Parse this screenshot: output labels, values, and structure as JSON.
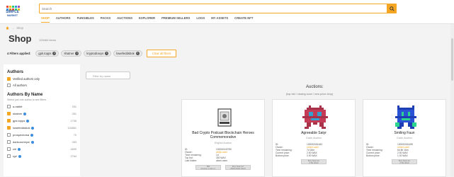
{
  "logo": {
    "text1": "SIMPLE",
    "text2": "MARKET",
    "text3": "PLACE"
  },
  "search": {
    "placeholder": "Search"
  },
  "nav": [
    "SHOP",
    "AUTHORS",
    "FUNGIBLES",
    "PACKS",
    "AUCTIONS",
    "EXPLORER",
    "PREMIUM SELLERS",
    "LOGS",
    "MY ASSETS",
    "CREATE NFT"
  ],
  "breadcrumb": {
    "current": "Shop"
  },
  "page": {
    "title": "Shop",
    "count": "125464 items"
  },
  "filters": {
    "label": "4 Filters applied:",
    "chips": [
      "gpk.topps",
      "shatner",
      "kryptodraxys",
      "lowefeddsbok"
    ],
    "clear_label": "Clear all filters"
  },
  "sidebar": {
    "title": "Authors",
    "verified_label": "Verified authors only",
    "all_label": "All authors",
    "name_title": "Authors By Name",
    "name_sub": "Select just one author to see filters",
    "authors": [
      {
        "name": "a.rabbit",
        "count": "251",
        "checked": false,
        "verified": false
      },
      {
        "name": "shatner",
        "count": "261",
        "checked": true,
        "verified": true
      },
      {
        "name": "gpk.topps",
        "count": "1706",
        "checked": true,
        "verified": true
      },
      {
        "name": "lowefeddsbok",
        "count": "124861",
        "checked": true,
        "verified": true
      },
      {
        "name": "prospectorsa",
        "count": "70",
        "checked": false,
        "verified": true
      },
      {
        "name": "darkcountryw",
        "count": "283",
        "checked": false,
        "verified": true
      },
      {
        "name": "clrl",
        "count": "4899",
        "checked": false,
        "verified": true
      },
      {
        "name": "rgrl",
        "count": "2784",
        "checked": false,
        "verified": true
      }
    ]
  },
  "filterbox": {
    "placeholder": "Filter by name"
  },
  "auctions": {
    "heading": "Auctions:",
    "sub": "(top bid / closing soon / new price drop)"
  },
  "cards": [
    {
      "title": "Bad Crypto Podcast Blockchain Heroes Commemorative",
      "type": "English Auction",
      "rows": [
        [
          "ID:",
          "100000043780"
        ],
        [
          "Owner:",
          "willyb.wam"
        ],
        [
          "Time remaining:",
          "1d"
        ],
        [
          "Top bid:",
          "300 WAX"
        ],
        [
          "Last bidder:",
          "abcm.wam"
        ]
      ],
      "btn1": "Bid",
      "btn1b": "Auction ends in:",
      "btn2": "Buy Now for",
      "btn2b": "2500.0000 WAX"
    },
    {
      "title": "Agreeable Satyr",
      "type": "Dutch Auction",
      "rows": [
        [
          "ID:",
          "100000051463"
        ],
        [
          "Owner:",
          "mmmf.wam"
        ],
        [
          "Time remaining:",
          "7d 18m"
        ],
        [
          "Current price:",
          "2.50 WAX"
        ],
        [
          "Bottom price:",
          "0.90 WAX"
        ]
      ],
      "btn1": "Buy Now for",
      "btn1b": "2.50 WAX"
    },
    {
      "title": "Smiling Faun",
      "type": "Dutch Auction",
      "rows": [
        [
          "ID:",
          "100000051459"
        ],
        [
          "Owner:",
          "mmmf.wam"
        ],
        [
          "Time remaining:",
          "6d 8h 16m"
        ],
        [
          "Current price:",
          "2.50 WAX"
        ],
        [
          "Bottom price:",
          "1.00 WAX"
        ]
      ],
      "btn1": "Buy Now for",
      "btn1b": "2.50 WAX"
    }
  ],
  "colors": {
    "accent": "#f5a623",
    "verified": "#3a8de0"
  }
}
